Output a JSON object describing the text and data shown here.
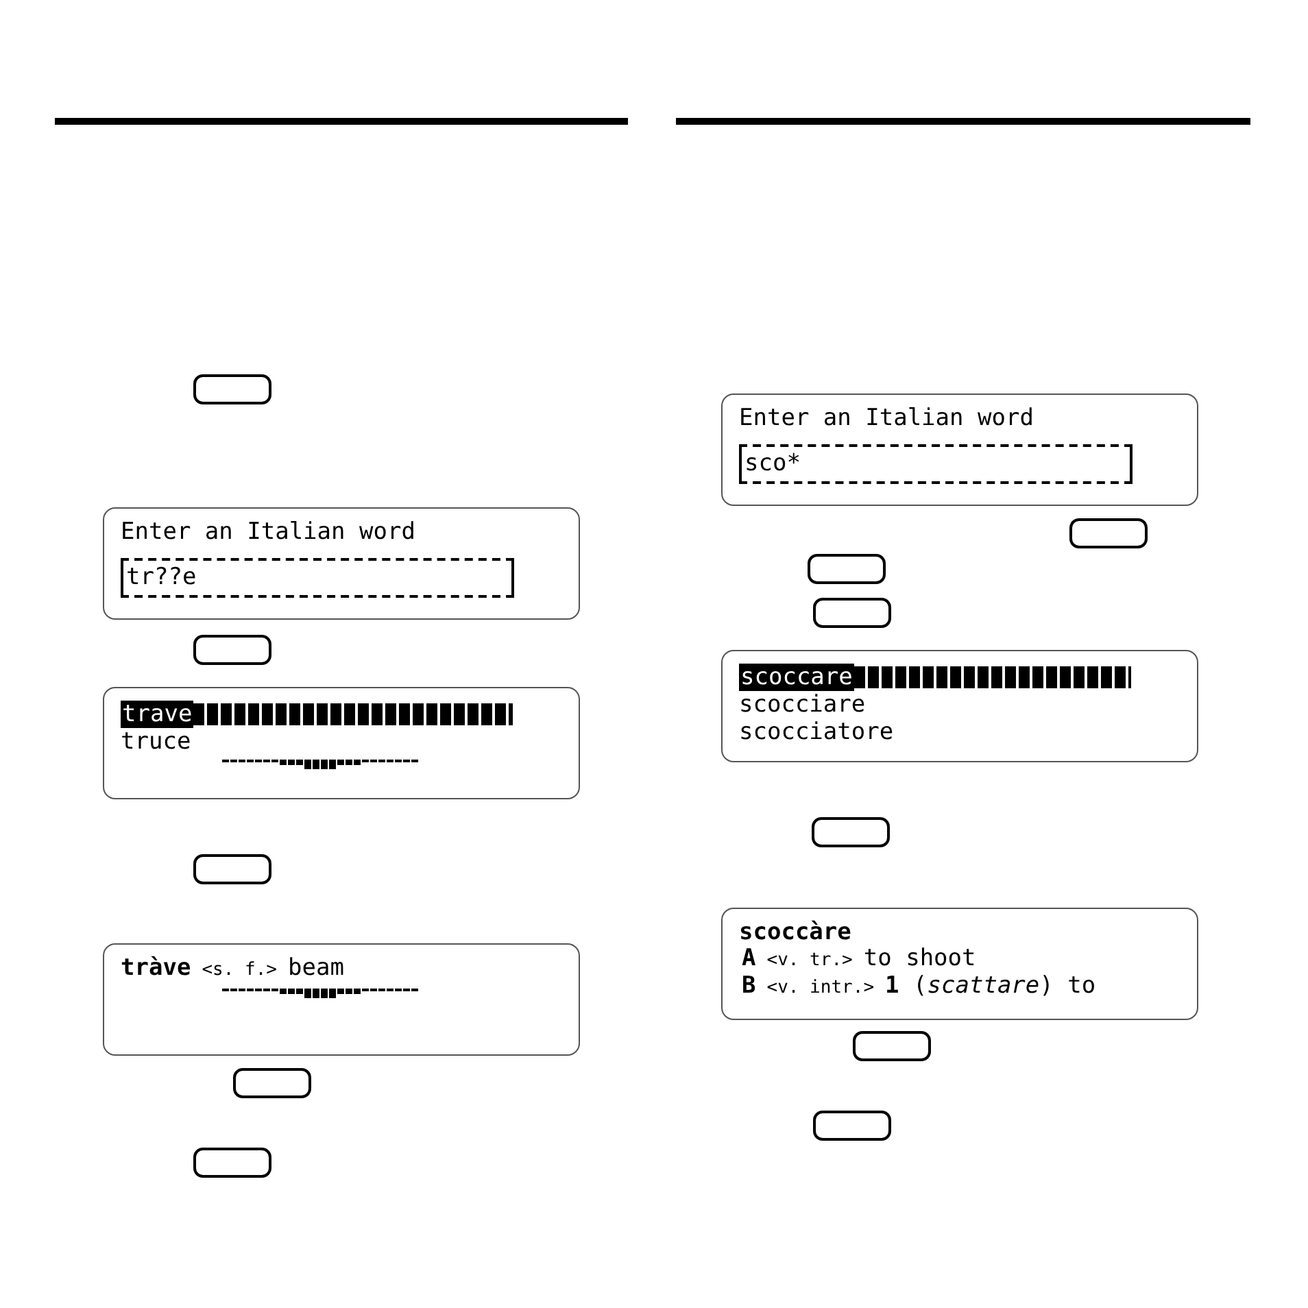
{
  "left_column": {
    "steps": [
      {
        "kind": "key"
      },
      {
        "kind": "input",
        "prompt": "Enter an Italian word",
        "value": "tr??e"
      },
      {
        "kind": "key"
      },
      {
        "kind": "list",
        "items": [
          {
            "word": "trave",
            "selected": true
          },
          {
            "word": "truce",
            "selected": false
          }
        ],
        "scroll_indicator": true
      },
      {
        "kind": "key"
      },
      {
        "kind": "entry",
        "headword": "tràve",
        "grammar": "<s. f.>",
        "gloss": "beam",
        "scroll_indicator": true
      },
      {
        "kind": "key"
      },
      {
        "kind": "key"
      }
    ]
  },
  "right_column": {
    "steps": [
      {
        "kind": "input",
        "prompt": "Enter an Italian word",
        "value": "sco*"
      },
      {
        "kind": "key"
      },
      {
        "kind": "key"
      },
      {
        "kind": "key"
      },
      {
        "kind": "list",
        "items": [
          {
            "word": "scoccare",
            "selected": true
          },
          {
            "word": "scocciare",
            "selected": false
          },
          {
            "word": "scocciatore",
            "selected": false
          }
        ],
        "scroll_indicator": false
      },
      {
        "kind": "key"
      },
      {
        "kind": "entry",
        "headword": "scoccàre",
        "senses": [
          {
            "label": "A",
            "grammar": "<v. tr.>",
            "text": "to shoot"
          },
          {
            "label": "B",
            "grammar": "<v. intr.>",
            "text": "**1** (*scattare*) to"
          }
        ],
        "scroll_indicator": false
      },
      {
        "kind": "key"
      },
      {
        "kind": "key"
      }
    ]
  }
}
